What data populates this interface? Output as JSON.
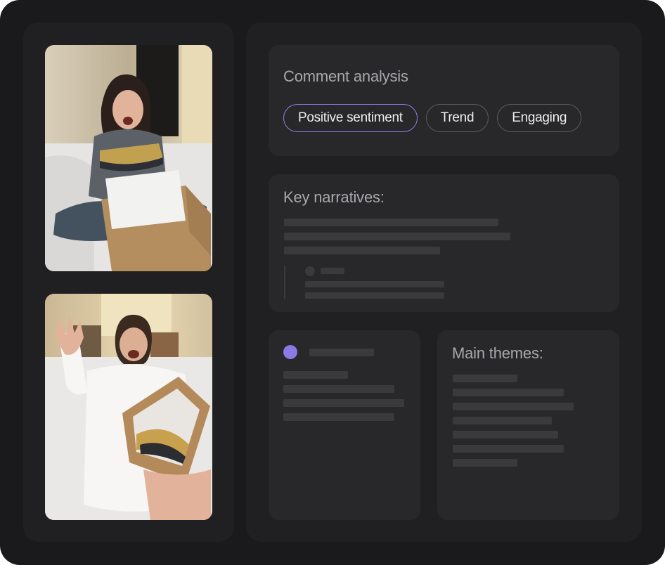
{
  "analysis": {
    "title": "Comment analysis",
    "tags": [
      {
        "label": "Positive sentiment",
        "active": true
      },
      {
        "label": "Trend",
        "active": false
      },
      {
        "label": "Engaging",
        "active": false
      }
    ]
  },
  "narratives": {
    "title": "Key narratives:"
  },
  "themes": {
    "title": "Main themes:"
  },
  "colors": {
    "accent": "#8c79e3",
    "tag_active_border": "#8f7fe6",
    "background": "#1a191b",
    "panel": "#201f21",
    "card": "#282729",
    "placeholder": "#3a393c"
  }
}
